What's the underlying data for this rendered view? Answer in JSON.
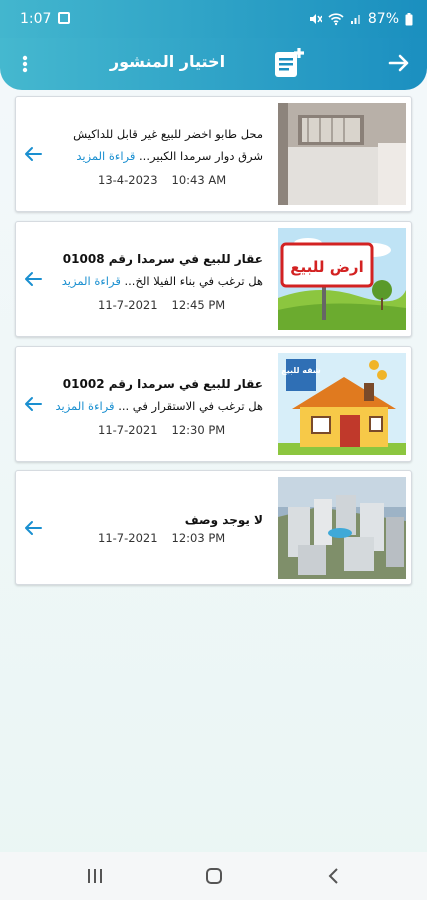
{
  "status": {
    "time": "1:07",
    "battery": "87%"
  },
  "header": {
    "title": "اختيار المنشور"
  },
  "posts": [
    {
      "line1": "محل طابو اخضر للبيع غير قابل للداكيش",
      "line2_pre": "شرق دوار سرمدا الكبير...",
      "read_more": "قراءة المزيد",
      "date": "13-4-2023",
      "time": "10:43 AM"
    },
    {
      "line1": "عقار للبيع في سرمدا رقم 01008",
      "line2_pre": "هل ترغب في بناء الفيلا الخ...",
      "read_more": "قراءة المزيد",
      "date": "11-7-2021",
      "time": "12:45 PM"
    },
    {
      "line1": "عقار للبيع في سرمدا رقم 01002",
      "line2_pre": "هل ترغب في الاستقرار في ...",
      "read_more": "قراءة المزيد",
      "date": "11-7-2021",
      "time": "12:30 PM"
    },
    {
      "line1": "لا يوجد وصف",
      "date": "11-7-2021",
      "time": "12:03 PM"
    }
  ],
  "images": {
    "sign_text": "ارض للبيع",
    "house_text": "شقه للبيع"
  },
  "colors": {
    "accent": "#1a8fd0",
    "header_start": "#45b8cf",
    "header_end": "#1b8fc0"
  }
}
